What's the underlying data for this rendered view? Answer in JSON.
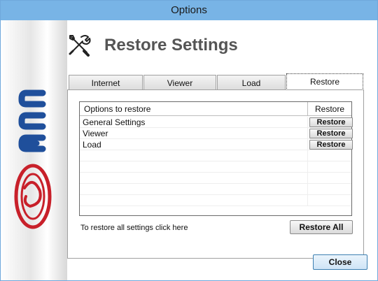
{
  "window": {
    "title": "Options"
  },
  "header": {
    "title": "Restore Settings",
    "icon": "tools-icon"
  },
  "tabs": [
    {
      "label": "Internet",
      "active": false
    },
    {
      "label": "Viewer",
      "active": false
    },
    {
      "label": "Load",
      "active": false
    },
    {
      "label": "Restore",
      "active": true
    }
  ],
  "restore_table": {
    "columns": [
      "Options to restore",
      "Restore"
    ],
    "rows": [
      {
        "name": "General Settings",
        "button": "Restore"
      },
      {
        "name": "Viewer",
        "button": "Restore"
      },
      {
        "name": "Load",
        "button": "Restore"
      }
    ]
  },
  "footer": {
    "hint": "To restore all settings click here",
    "restore_all_label": "Restore All",
    "close_label": "Close"
  },
  "colors": {
    "title_bar": "#78b4e6",
    "logo_red": "#c8202a",
    "logo_blue": "#1f4f9b"
  }
}
